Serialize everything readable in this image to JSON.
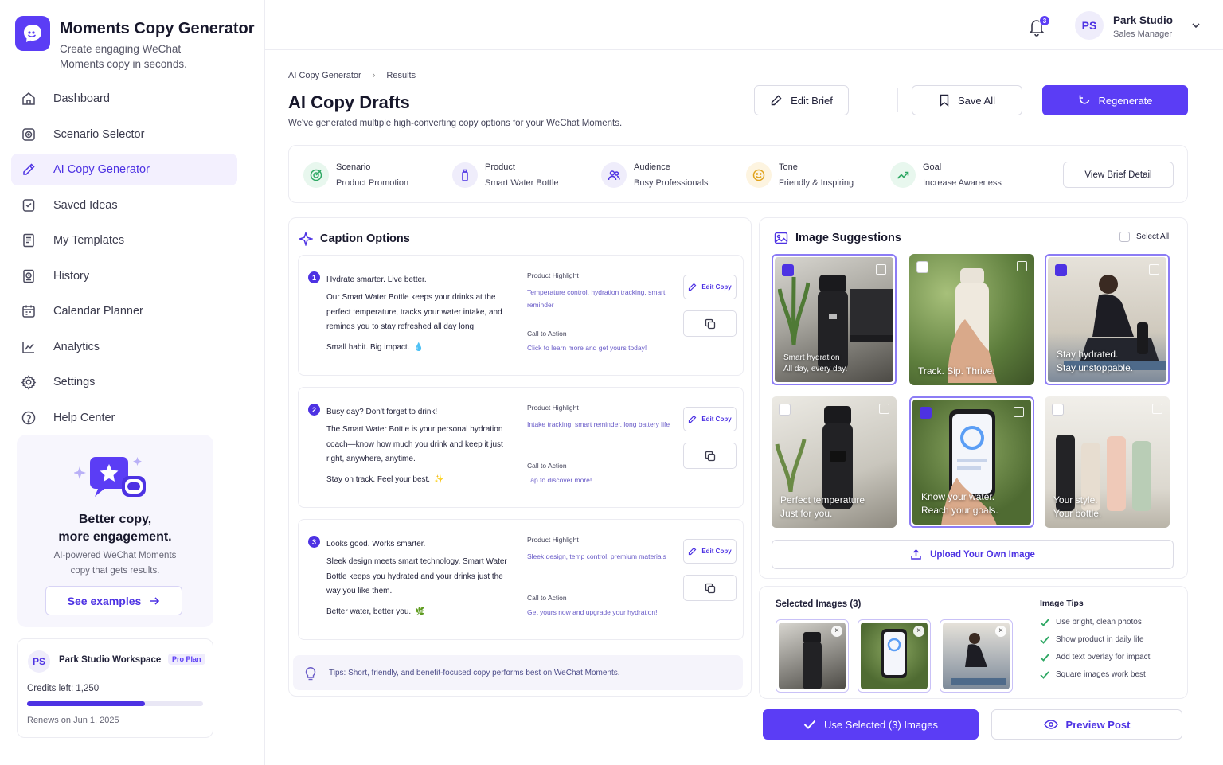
{
  "app": {
    "title": "Moments Copy Generator",
    "subtitle": "Create engaging WeChat Moments copy in seconds."
  },
  "nav": [
    {
      "label": "Dashboard",
      "icon": "home-icon"
    },
    {
      "label": "Scenario Selector",
      "icon": "target-icon"
    },
    {
      "label": "AI Copy Generator",
      "icon": "pen-icon",
      "active": true
    },
    {
      "label": "Saved Ideas",
      "icon": "bookmark-icon"
    },
    {
      "label": "My Templates",
      "icon": "template-icon"
    },
    {
      "label": "History",
      "icon": "history-icon"
    },
    {
      "label": "Calendar Planner",
      "icon": "calendar-icon"
    },
    {
      "label": "Analytics",
      "icon": "chart-icon"
    },
    {
      "label": "Settings",
      "icon": "gear-icon"
    },
    {
      "label": "Help Center",
      "icon": "help-icon"
    }
  ],
  "promo": {
    "title_line1": "Better copy,",
    "title_line2": "more engagement.",
    "text_line1": "AI-powered WeChat Moments",
    "text_line2": "copy that gets results.",
    "button": "See examples"
  },
  "workspace": {
    "initials": "PS",
    "name": "Park Studio Workspace",
    "plan": "Pro Plan",
    "credits": "Credits left: 1,250",
    "credits_fraction": 0.67,
    "renews": "Renews on Jun 1, 2025"
  },
  "topbar": {
    "notifications": "3",
    "user_initials": "PS",
    "user_name": "Park Studio",
    "user_role": "Sales Manager"
  },
  "breadcrumb": [
    "AI Copy Generator",
    "Results"
  ],
  "page": {
    "title": "AI Copy Drafts",
    "subtitle": "We've generated multiple high-converting copy options for your WeChat Moments."
  },
  "actions": {
    "edit_brief": "Edit Brief",
    "save_all": "Save All",
    "regenerate": "Regenerate"
  },
  "brief": {
    "items": [
      {
        "label": "Scenario",
        "value": "Product Promotion"
      },
      {
        "label": "Product",
        "value": "Smart Water Bottle"
      },
      {
        "label": "Audience",
        "value": "Busy Professionals"
      },
      {
        "label": "Tone",
        "value": "Friendly & Inspiring"
      },
      {
        "label": "Goal",
        "value": "Increase Awareness"
      }
    ],
    "button": "View Brief Detail"
  },
  "captions": {
    "title": "Caption Options",
    "highlight_label": "Product Highlight",
    "cta_label": "Call to Action",
    "edit_label": "Edit Copy",
    "items": [
      {
        "num": "1",
        "headline": "Hydrate smarter. Live better.",
        "body": "Our Smart Water Bottle keeps your drinks at the perfect temperature, tracks your water intake, and reminds you to stay refreshed all day long.",
        "closing": "Small habit. Big impact.",
        "emoji": "💧",
        "highlight": "Temperature control, hydration tracking, smart reminder",
        "cta": "Click to learn more and get yours today!"
      },
      {
        "num": "2",
        "headline": "Busy day? Don't forget to drink!",
        "body": "The Smart Water Bottle is your personal hydration coach—know how much you drink and keep it just right, anywhere, anytime.",
        "closing": "Stay on track. Feel your best.",
        "emoji": "✨",
        "highlight": "Intake tracking, smart reminder, long battery life",
        "cta": "Tap to discover more!"
      },
      {
        "num": "3",
        "headline": "Looks good. Works smarter.",
        "body": "Sleek design meets smart technology. Smart Water Bottle keeps you hydrated and your drinks just the way you like them.",
        "closing": "Better water, better you.",
        "emoji": "🌿",
        "highlight": "Sleek design, temp control, premium materials",
        "cta": "Get yours now and upgrade your hydration!"
      }
    ],
    "tips": "Tips: Short, friendly, and benefit-focused copy performs best on WeChat Moments."
  },
  "images": {
    "title": "Image Suggestions",
    "select_all": "Select All",
    "items": [
      {
        "line1": "Smart hydration",
        "line2": "All day, every day.",
        "selected": true
      },
      {
        "line1": "Track. Sip. Thrive.",
        "line2": "",
        "selected": false
      },
      {
        "line1": "Stay hydrated.",
        "line2": "Stay unstoppable.",
        "selected": true
      },
      {
        "line1": "Perfect temperature",
        "line2": "Just for you.",
        "selected": false
      },
      {
        "line1": "Know your water.",
        "line2": "Reach your goals.",
        "selected": true
      },
      {
        "line1": "Your style.",
        "line2": "Your bottle.",
        "selected": false
      }
    ],
    "upload": "Upload Your Own Image"
  },
  "selected": {
    "title": "Selected Images (3)"
  },
  "image_tips": {
    "title": "Image Tips",
    "items": [
      "Use bright, clean photos",
      "Show product in daily life",
      "Add text overlay for impact",
      "Square images work best"
    ]
  },
  "footer": {
    "use_selected": "Use Selected (3) Images",
    "preview": "Preview Post"
  },
  "colors": {
    "accent": "#5b3df5"
  }
}
